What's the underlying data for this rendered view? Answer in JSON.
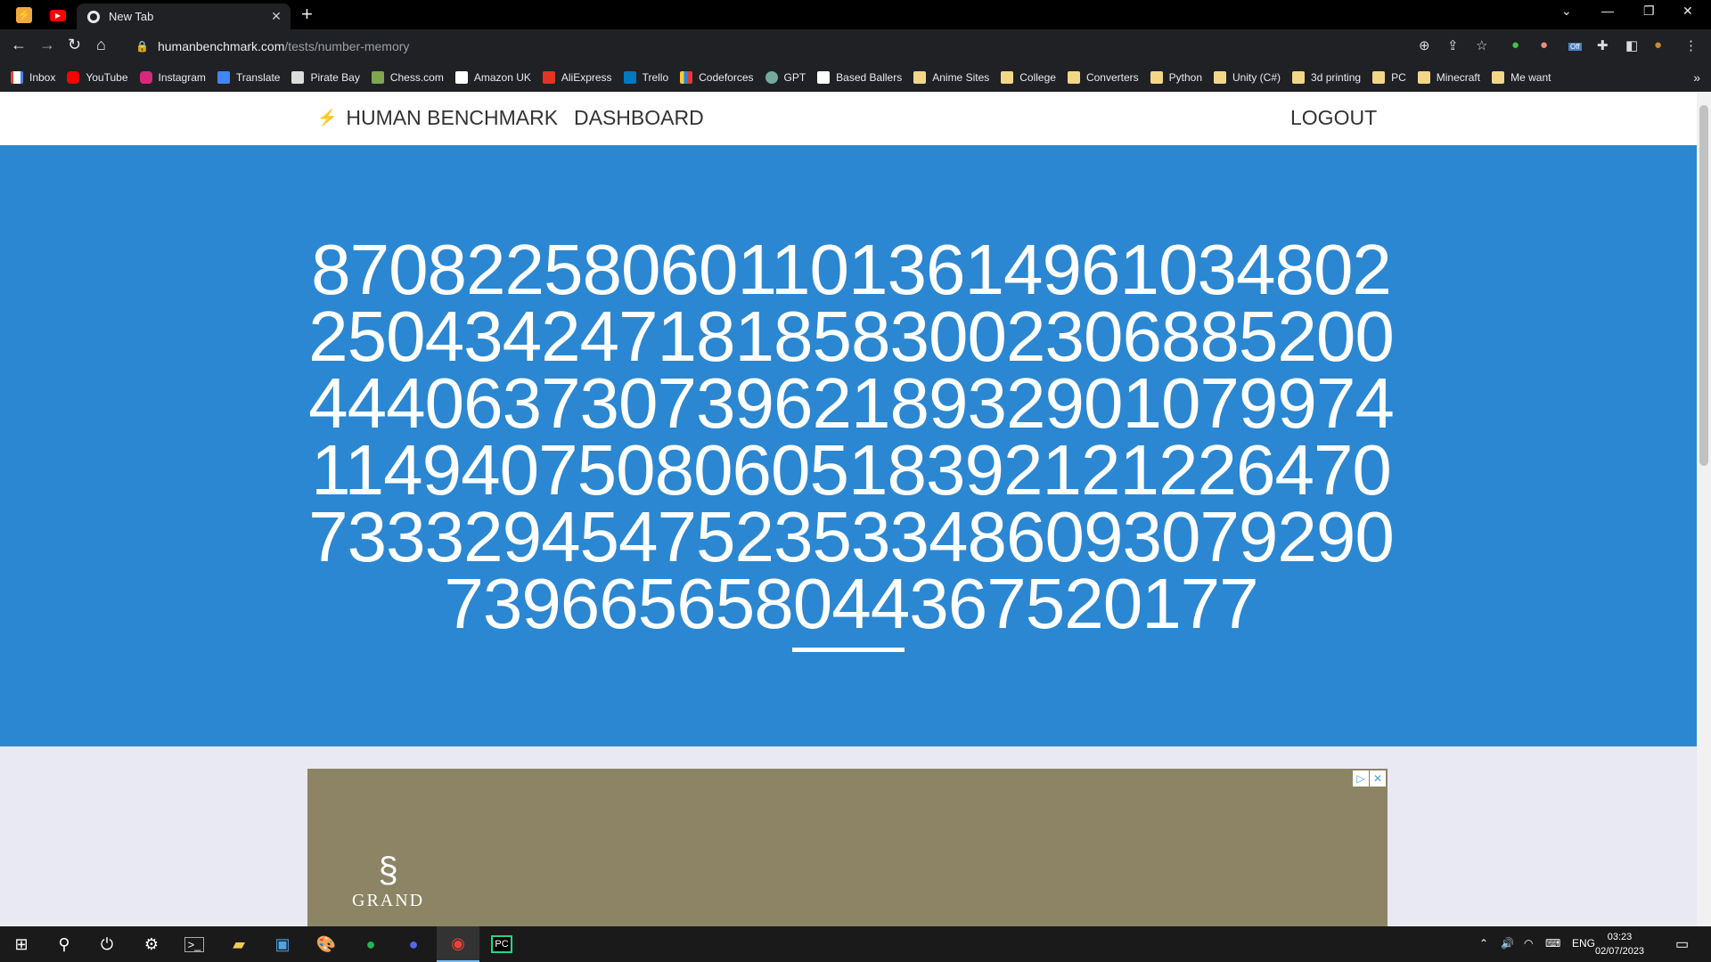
{
  "browser": {
    "tab_title": "New Tab",
    "url_host": "humanbenchmark.com",
    "url_path": "/tests/number-memory",
    "bookmarks": [
      {
        "label": "Inbox",
        "icon": "gmail-icon"
      },
      {
        "label": "YouTube",
        "icon": "youtube-icon"
      },
      {
        "label": "Instagram",
        "icon": "instagram-icon"
      },
      {
        "label": "Translate",
        "icon": "translate-icon"
      },
      {
        "label": "Pirate Bay",
        "icon": "piratebay-icon"
      },
      {
        "label": "Chess.com",
        "icon": "chess-icon"
      },
      {
        "label": "Amazon UK",
        "icon": "amazon-icon"
      },
      {
        "label": "AliExpress",
        "icon": "aliexpress-icon"
      },
      {
        "label": "Trello",
        "icon": "trello-icon"
      },
      {
        "label": "Codeforces",
        "icon": "codeforces-icon"
      },
      {
        "label": "GPT",
        "icon": "gpt-icon"
      },
      {
        "label": "Based Ballers",
        "icon": "v-icon"
      },
      {
        "label": "Anime Sites",
        "icon": "folder-icon"
      },
      {
        "label": "College",
        "icon": "folder-icon"
      },
      {
        "label": "Converters",
        "icon": "folder-icon"
      },
      {
        "label": "Python",
        "icon": "folder-icon"
      },
      {
        "label": "Unity (C#)",
        "icon": "folder-icon"
      },
      {
        "label": "3d printing",
        "icon": "folder-icon"
      },
      {
        "label": "PC",
        "icon": "folder-icon"
      },
      {
        "label": "Minecraft",
        "icon": "folder-icon"
      },
      {
        "label": "Me want",
        "icon": "folder-icon"
      }
    ],
    "extension_badge": "Off"
  },
  "site": {
    "brand": "HUMAN BENCHMARK",
    "dashboard": "DASHBOARD",
    "logout": "LOGOUT"
  },
  "test": {
    "number": "87082258060110136149610348022504342471818583002306885200444063730739621893290107997411494075080605183921212264707333294547523533486093079290739665658044367520177"
  },
  "ad": {
    "logo_text": "GRAND"
  },
  "taskbar": {
    "language": "ENG",
    "time": "03:23",
    "date": "02/07/2023"
  },
  "colors": {
    "hero": "#2b87d1",
    "page_bg": "#e8e9f3",
    "ad_bg": "#8c8464"
  }
}
